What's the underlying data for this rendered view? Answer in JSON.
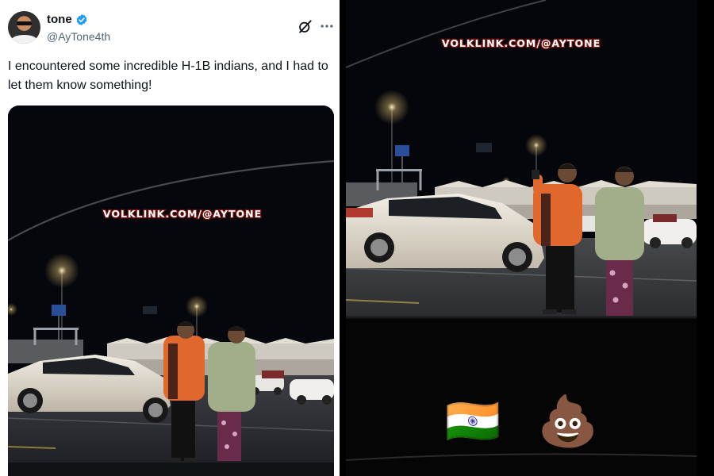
{
  "tweet": {
    "display_name": "tone",
    "handle": "@AyTone4th",
    "text": "I encountered some incredible H-1B indians, and I had to let them know something!",
    "icons": {
      "verified": "verified-badge-icon",
      "grok": "grok-icon",
      "more": "more-dots-icon"
    },
    "colors": {
      "name": "#0f1419",
      "handle": "#536471",
      "verified": "#1d9bf0"
    }
  },
  "media": {
    "watermark": "VOLKLINK.COM/@AYTONE"
  },
  "video_frame": {
    "watermark": "VOLKLINK.COM/@AYTONE",
    "emojis": [
      "🇮🇳",
      "💩"
    ],
    "emoji_names": [
      "india-flag-emoji",
      "poop-emoji"
    ]
  }
}
